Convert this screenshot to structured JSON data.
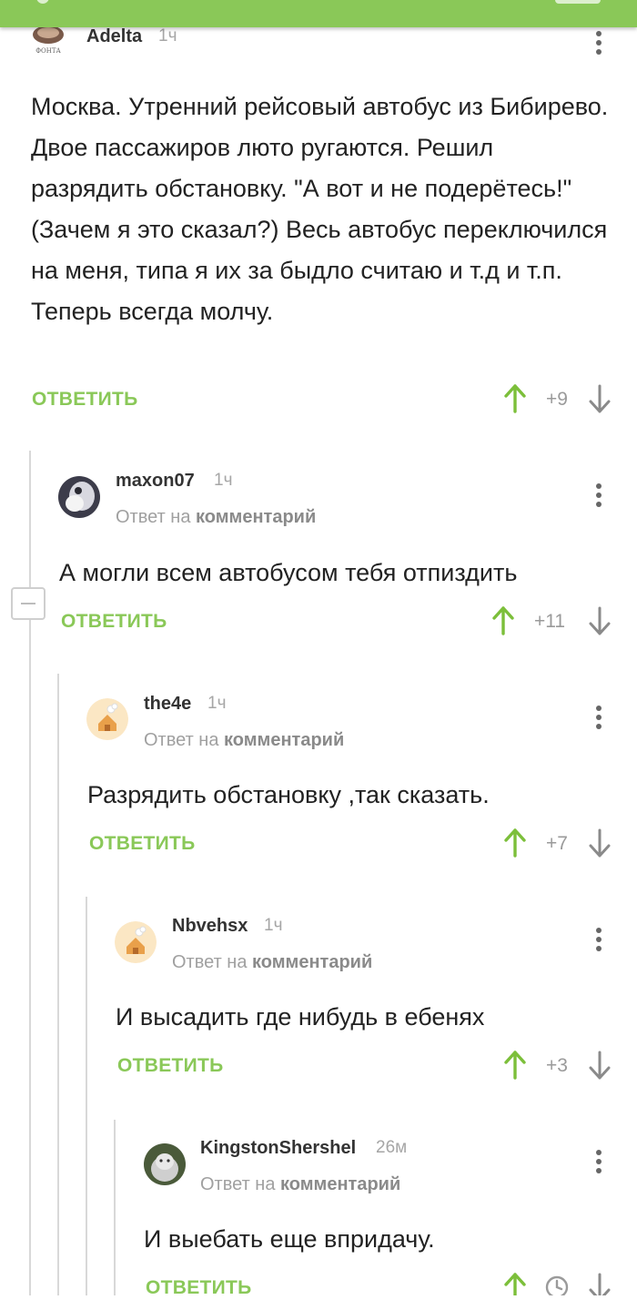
{
  "theme": {
    "accent": "#8ac858",
    "upvote": "#7cbf3a",
    "muted": "#a6a6a6"
  },
  "reply_label": "ОТВЕТИТЬ",
  "comments": [
    {
      "user": "Adelta",
      "time": "1ч",
      "reply_prefix": "",
      "reply_target": "",
      "text": "Москва. Утренний рейсовый автобус из Бибирево. Двое пассажиров люто ругаются. Решил разрядить обстановку. \"А вот и не подерётесь!\" (Зачем я это сказал?) Весь автобус переключился на меня, типа я их за быдло считаю и т.д и т.п. Теперь всегда молчу.",
      "rating": "+9"
    },
    {
      "user": "maxon07",
      "time": "1ч",
      "reply_prefix": "Ответ на ",
      "reply_target": "комментарий",
      "text": "А могли всем автобусом тебя отпиздить",
      "rating": "+11"
    },
    {
      "user": "the4e",
      "time": "1ч",
      "reply_prefix": "Ответ на ",
      "reply_target": "комментарий",
      "text": "Разрядить обстановку ,так сказать.",
      "rating": "+7"
    },
    {
      "user": "Nbvehsx",
      "time": "1ч",
      "reply_prefix": "Ответ на ",
      "reply_target": "комментарий",
      "text": "И высадить где нибудь в ебенях",
      "rating": "+3"
    },
    {
      "user": "KingstonShershel",
      "time": "26м",
      "reply_prefix": "Ответ на ",
      "reply_target": "комментарий",
      "text": "И выебать еще впридачу.",
      "rating": ""
    }
  ]
}
